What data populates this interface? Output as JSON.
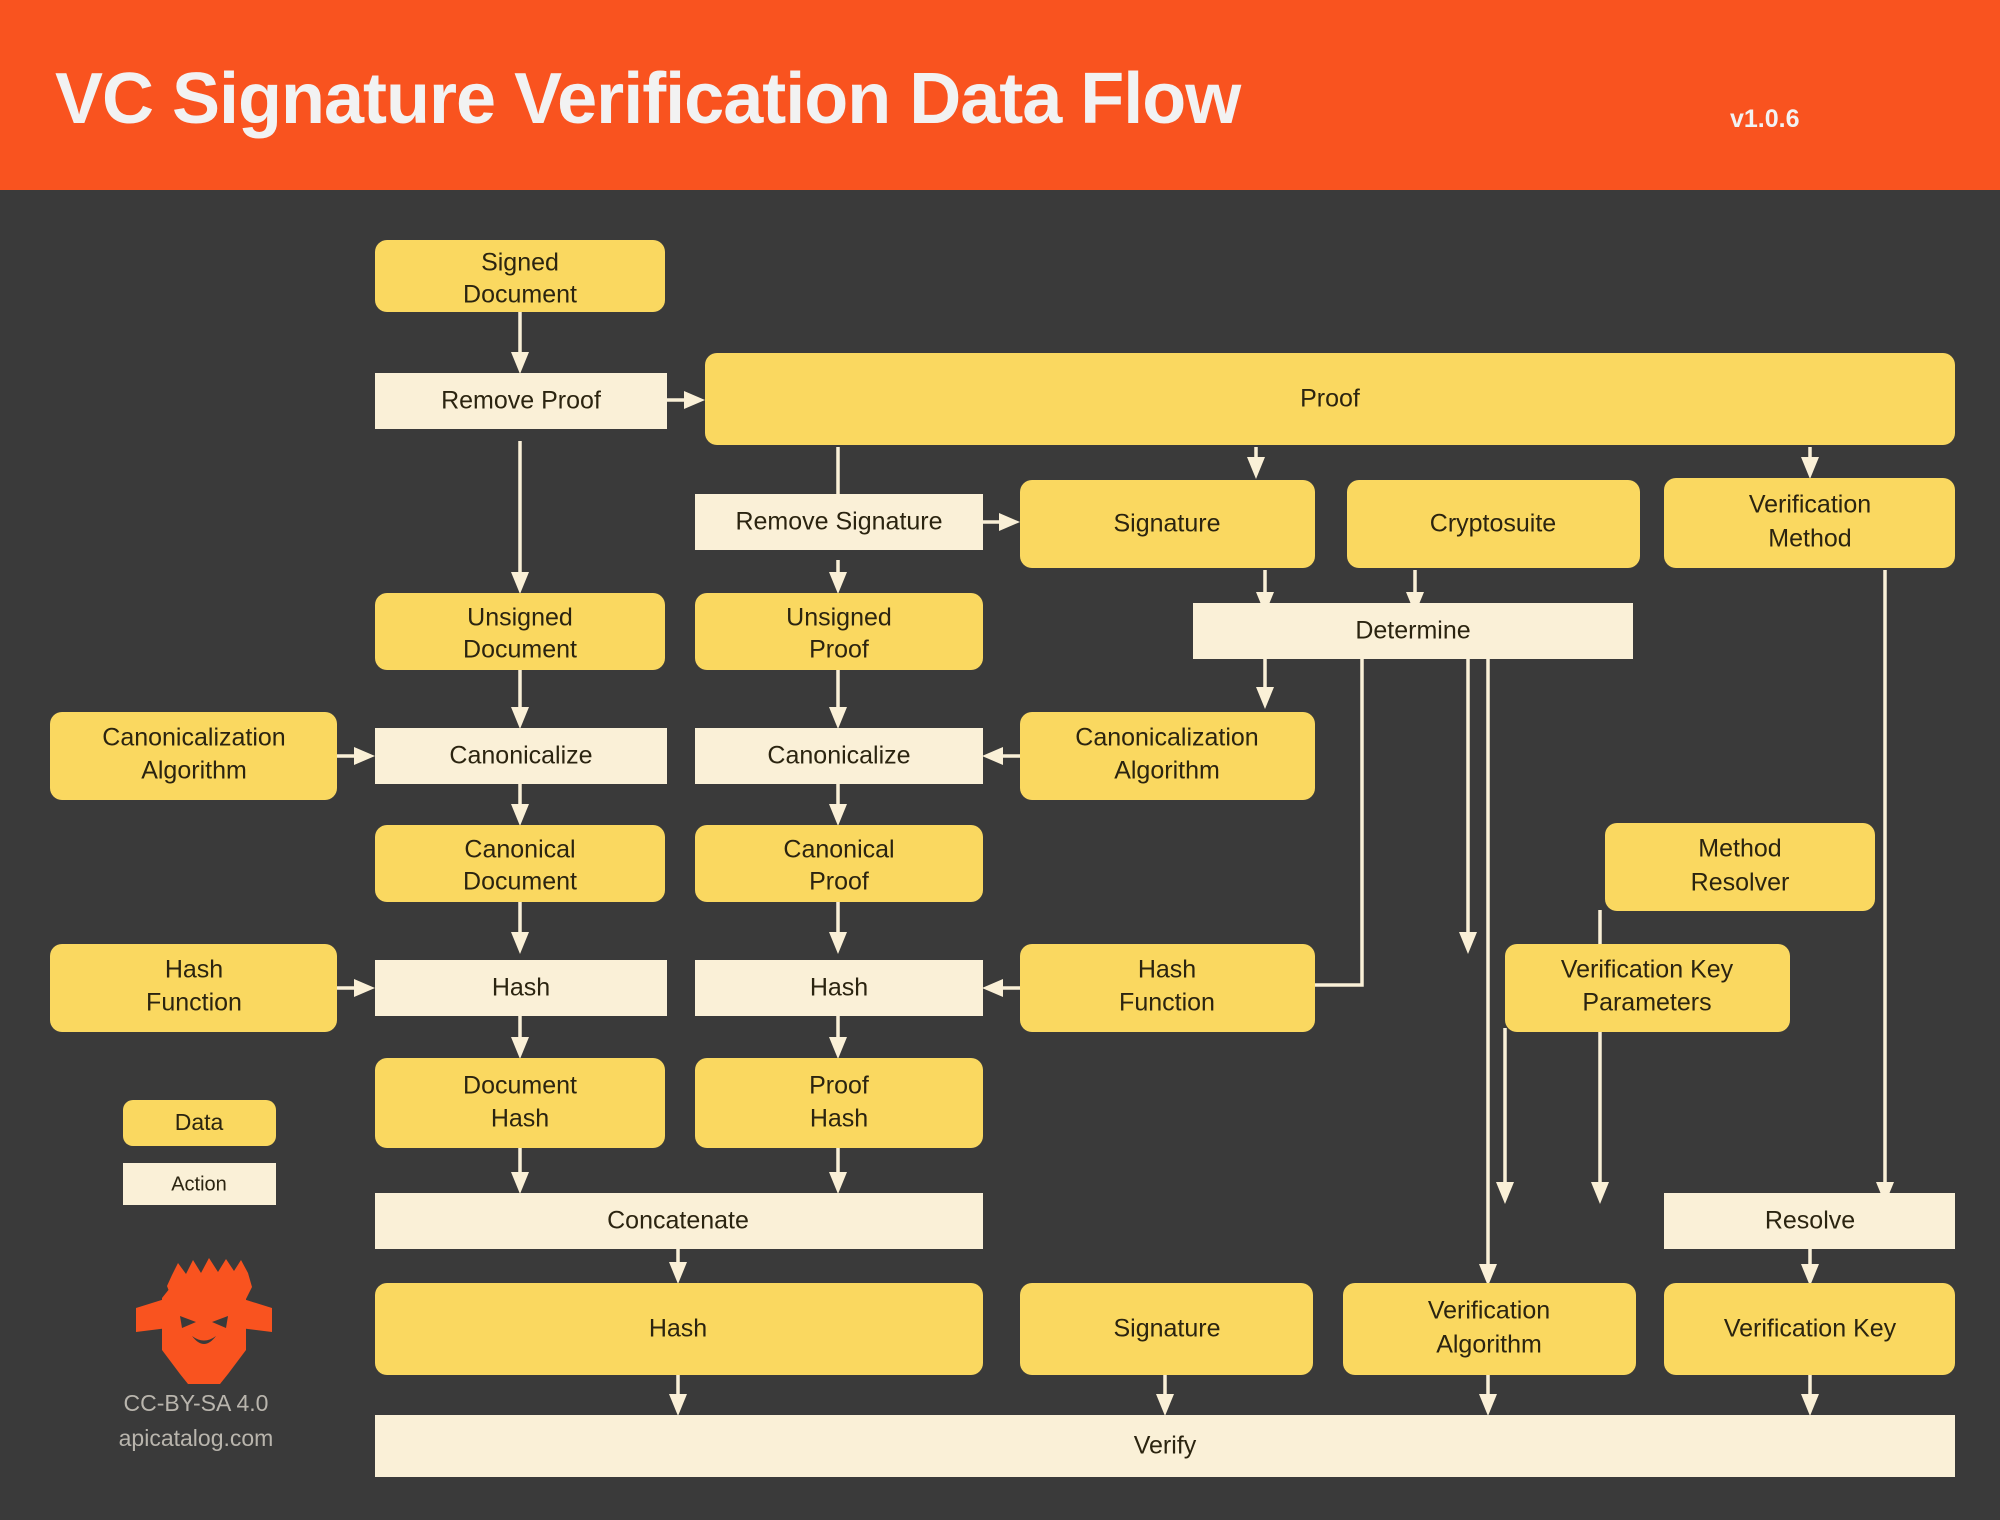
{
  "header": {
    "title": "VC Signature Verification Data Flow",
    "version": "v1.0.6",
    "bar_color": "#f9531f",
    "title_color": "#f2f2f2"
  },
  "theme": {
    "background": "#3a3a3a",
    "data_color": "#fad860",
    "action_color": "#faf0d7",
    "edge_color": "#faf0d7",
    "text_color": "#2b2410"
  },
  "legend": {
    "data_label": "Data",
    "action_label": "Action"
  },
  "attribution": {
    "license": "CC-BY-SA 4.0",
    "site": "apicatalog.com",
    "logo": "sheep-head-logo"
  },
  "diagram": {
    "type": "flowchart",
    "orientation": "top-down",
    "nodes": [
      {
        "id": "signed_document",
        "label": "Signed Document",
        "kind": "data"
      },
      {
        "id": "remove_proof",
        "label": "Remove Proof",
        "kind": "action"
      },
      {
        "id": "proof",
        "label": "Proof",
        "kind": "data"
      },
      {
        "id": "remove_signature",
        "label": "Remove Signature",
        "kind": "action"
      },
      {
        "id": "signature_top",
        "label": "Signature",
        "kind": "data"
      },
      {
        "id": "cryptosuite",
        "label": "Cryptosuite",
        "kind": "data"
      },
      {
        "id": "verification_method",
        "label": "Verification Method",
        "kind": "data"
      },
      {
        "id": "unsigned_document",
        "label": "Unsigned Document",
        "kind": "data"
      },
      {
        "id": "unsigned_proof",
        "label": "Unsigned Proof",
        "kind": "data"
      },
      {
        "id": "determine",
        "label": "Determine",
        "kind": "action"
      },
      {
        "id": "canon_algo_left",
        "label": "Canonicalization Algorithm",
        "kind": "data"
      },
      {
        "id": "canonicalize_doc",
        "label": "Canonicalize",
        "kind": "action"
      },
      {
        "id": "canonicalize_proof",
        "label": "Canonicalize",
        "kind": "action"
      },
      {
        "id": "canon_algo_right",
        "label": "Canonicalization Algorithm",
        "kind": "data"
      },
      {
        "id": "canonical_document",
        "label": "Canonical Document",
        "kind": "data"
      },
      {
        "id": "canonical_proof",
        "label": "Canonical Proof",
        "kind": "data"
      },
      {
        "id": "method_resolver",
        "label": "Method Resolver",
        "kind": "data"
      },
      {
        "id": "hash_fn_left",
        "label": "Hash Function",
        "kind": "data"
      },
      {
        "id": "hash_doc",
        "label": "Hash",
        "kind": "action"
      },
      {
        "id": "hash_proof",
        "label": "Hash",
        "kind": "action"
      },
      {
        "id": "hash_fn_right",
        "label": "Hash Function",
        "kind": "data"
      },
      {
        "id": "verification_key_params",
        "label": "Verification Key Parameters",
        "kind": "data"
      },
      {
        "id": "document_hash",
        "label": "Document Hash",
        "kind": "data"
      },
      {
        "id": "proof_hash",
        "label": "Proof Hash",
        "kind": "data"
      },
      {
        "id": "concatenate",
        "label": "Concatenate",
        "kind": "action"
      },
      {
        "id": "resolve",
        "label": "Resolve",
        "kind": "action"
      },
      {
        "id": "hash_final",
        "label": "Hash",
        "kind": "data"
      },
      {
        "id": "signature_bottom",
        "label": "Signature",
        "kind": "data"
      },
      {
        "id": "verification_algorithm",
        "label": "Verification Algorithm",
        "kind": "data"
      },
      {
        "id": "verification_key",
        "label": "Verification Key",
        "kind": "data"
      },
      {
        "id": "verify",
        "label": "Verify",
        "kind": "action"
      }
    ],
    "edges": [
      {
        "from": "signed_document",
        "to": "remove_proof"
      },
      {
        "from": "remove_proof",
        "to": "proof"
      },
      {
        "from": "remove_proof",
        "to": "unsigned_document"
      },
      {
        "from": "proof",
        "to": "remove_signature"
      },
      {
        "from": "proof",
        "to": "cryptosuite"
      },
      {
        "from": "proof",
        "to": "verification_method"
      },
      {
        "from": "remove_signature",
        "to": "signature_top"
      },
      {
        "from": "remove_signature",
        "to": "unsigned_proof"
      },
      {
        "from": "signature_top",
        "to": "determine"
      },
      {
        "from": "cryptosuite",
        "to": "determine"
      },
      {
        "from": "unsigned_document",
        "to": "canonicalize_doc"
      },
      {
        "from": "unsigned_proof",
        "to": "canonicalize_proof"
      },
      {
        "from": "canon_algo_left",
        "to": "canonicalize_doc"
      },
      {
        "from": "canon_algo_right",
        "to": "canonicalize_proof"
      },
      {
        "from": "determine",
        "to": "canon_algo_right"
      },
      {
        "from": "determine",
        "to": "hash_fn_right"
      },
      {
        "from": "determine",
        "to": "verification_key_params"
      },
      {
        "from": "determine",
        "to": "verification_algorithm"
      },
      {
        "from": "canonicalize_doc",
        "to": "canonical_document"
      },
      {
        "from": "canonicalize_proof",
        "to": "canonical_proof"
      },
      {
        "from": "canonical_document",
        "to": "hash_doc"
      },
      {
        "from": "canonical_proof",
        "to": "hash_proof"
      },
      {
        "from": "hash_fn_left",
        "to": "hash_doc"
      },
      {
        "from": "hash_fn_right",
        "to": "hash_proof"
      },
      {
        "from": "hash_doc",
        "to": "document_hash"
      },
      {
        "from": "hash_proof",
        "to": "proof_hash"
      },
      {
        "from": "document_hash",
        "to": "concatenate"
      },
      {
        "from": "proof_hash",
        "to": "concatenate"
      },
      {
        "from": "concatenate",
        "to": "hash_final"
      },
      {
        "from": "method_resolver",
        "to": "resolve"
      },
      {
        "from": "verification_key_params",
        "to": "resolve"
      },
      {
        "from": "verification_method",
        "to": "resolve"
      },
      {
        "from": "resolve",
        "to": "verification_key"
      },
      {
        "from": "hash_final",
        "to": "verify"
      },
      {
        "from": "signature_bottom",
        "to": "verify"
      },
      {
        "from": "verification_algorithm",
        "to": "verify"
      },
      {
        "from": "verification_key",
        "to": "verify"
      }
    ]
  }
}
